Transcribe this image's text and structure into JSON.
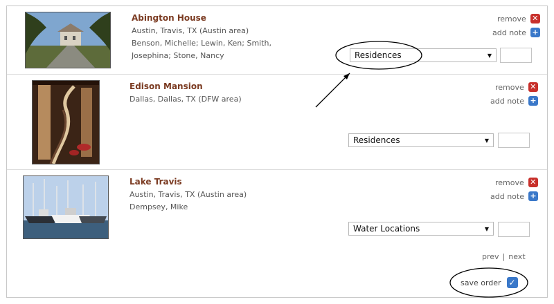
{
  "listing": {
    "items": [
      {
        "name": "Abington House",
        "location": "Austin, Travis, TX (Austin area)",
        "people_line1": "Benson, Michelle; Lewin, Ken; Smith,",
        "people_line2": "Josephina; Stone, Nancy",
        "remove_label": "remove",
        "add_note_label": "add note",
        "category": "Residences",
        "thumb_icon": "house-photo"
      },
      {
        "name": "Edison Mansion",
        "location": "Dallas, Dallas, TX (DFW area)",
        "remove_label": "remove",
        "add_note_label": "add note",
        "category": "Residences",
        "thumb_icon": "staircase-photo"
      },
      {
        "name": "Lake Travis",
        "location": "Austin, Travis, TX (Austin area)",
        "people_line1": "Dempsey, Mike",
        "remove_label": "remove",
        "add_note_label": "add note",
        "category": "Water Locations",
        "thumb_icon": "boats-photo"
      }
    ]
  },
  "pager": {
    "prev": "prev",
    "separator": "|",
    "next": "next"
  },
  "save": {
    "label": "save order"
  },
  "colors": {
    "name": "#7b3b22",
    "remove": "#c8302b",
    "add": "#3a78c9",
    "annotation": "#000000"
  }
}
